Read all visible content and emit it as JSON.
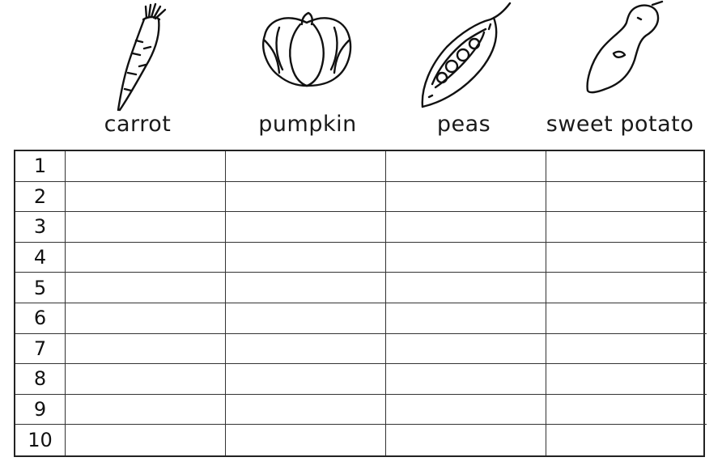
{
  "vegetables": [
    {
      "label": "carrot",
      "icon": "carrot-icon"
    },
    {
      "label": "pumpkin",
      "icon": "pumpkin-icon"
    },
    {
      "label": "peas",
      "icon": "peas-pod-icon"
    },
    {
      "label": "sweet potato",
      "icon": "sweet-potato-icon"
    }
  ],
  "rows": [
    "1",
    "2",
    "3",
    "4",
    "5",
    "6",
    "7",
    "8",
    "9",
    "10"
  ]
}
